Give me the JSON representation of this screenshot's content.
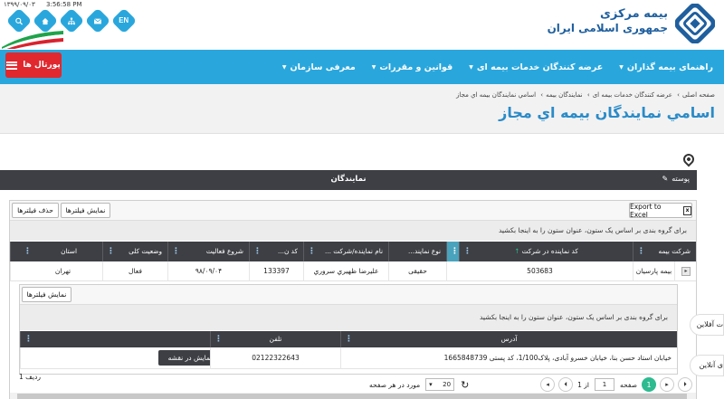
{
  "header": {
    "date": "۱۳۹۹/۰۹/۰۳",
    "time": "3:56:58 PM",
    "lang": "EN",
    "org_line1": "بیمه مرکزی",
    "org_line2": "جمهوری اسلامی ایران"
  },
  "nav": {
    "items": [
      "معرفی سازمان",
      "قوانین و مقررات",
      "عرضه کنندگان خدمات بیمه ای",
      "راهنمای بیمه گذاران"
    ],
    "portal_label": "پورتال ها"
  },
  "breadcrumb": [
    "صفحه اصلی",
    "عرضه کنندگان خدمات بیمه ای",
    "نمایندگان بیمه",
    "اسامي نمايندگان بيمه اي مجاز"
  ],
  "page_title": "اسامي نمايندگان بيمه اي مجاز",
  "section": {
    "tab_label": "نمایندگان",
    "post_label": "پوسته"
  },
  "grid": {
    "excel_label": "Export to Excel",
    "show_filters": "نمایش فیلترها",
    "clear_filters": "حذف فیلترها",
    "group_hint": "برای گروه بندی بر اساس یک ستون، عنوان ستون را به اینجا بکشید",
    "columns": [
      "شرکت بیمه",
      "کد نماینده در شرکت",
      "نوع نمايند...",
      "نام نماينده/شرکت ...",
      "کد ن...",
      "شروع فعالیت",
      "وضعیت کلی",
      "استان"
    ],
    "sort_arrow": "↑",
    "row": [
      "بیمه پارسیان",
      "503683",
      "حقیقی",
      "علیرضا ظهيري سروري",
      "133397",
      "۹۸/۰۹/۰۴",
      "فعال",
      "تهران"
    ],
    "expand_glyph": "▸"
  },
  "detail": {
    "show_filters": "نمایش فیلترها",
    "group_hint": "برای گروه بندی بر اساس یک ستون، عنوان ستون را به اینجا بکشید",
    "columns": [
      "آدرس",
      "تلفن"
    ],
    "address": "خیابان استاد حسن بنا، خیابان خسرو آبادی، پلاک1/100، کد پستی 1665848739",
    "phone": "02122322643",
    "map_button": "نمایش در نقشه"
  },
  "pager": {
    "current": "1",
    "page_label": "صفحه",
    "page_input": "1",
    "of_label": "از 1",
    "page_size": "20",
    "per_page_label": "مورد در هر صفحه",
    "row_label": "ردیف 1"
  },
  "side_tabs": [
    "ت آفلاین",
    "ی آنلاین"
  ],
  "colors": {
    "brand_blue": "#29a7dd",
    "dark_header": "#3d3f44",
    "accent_green": "#2dbb8f",
    "portal_red": "#e0282e",
    "title_blue": "#2a8bc8"
  }
}
